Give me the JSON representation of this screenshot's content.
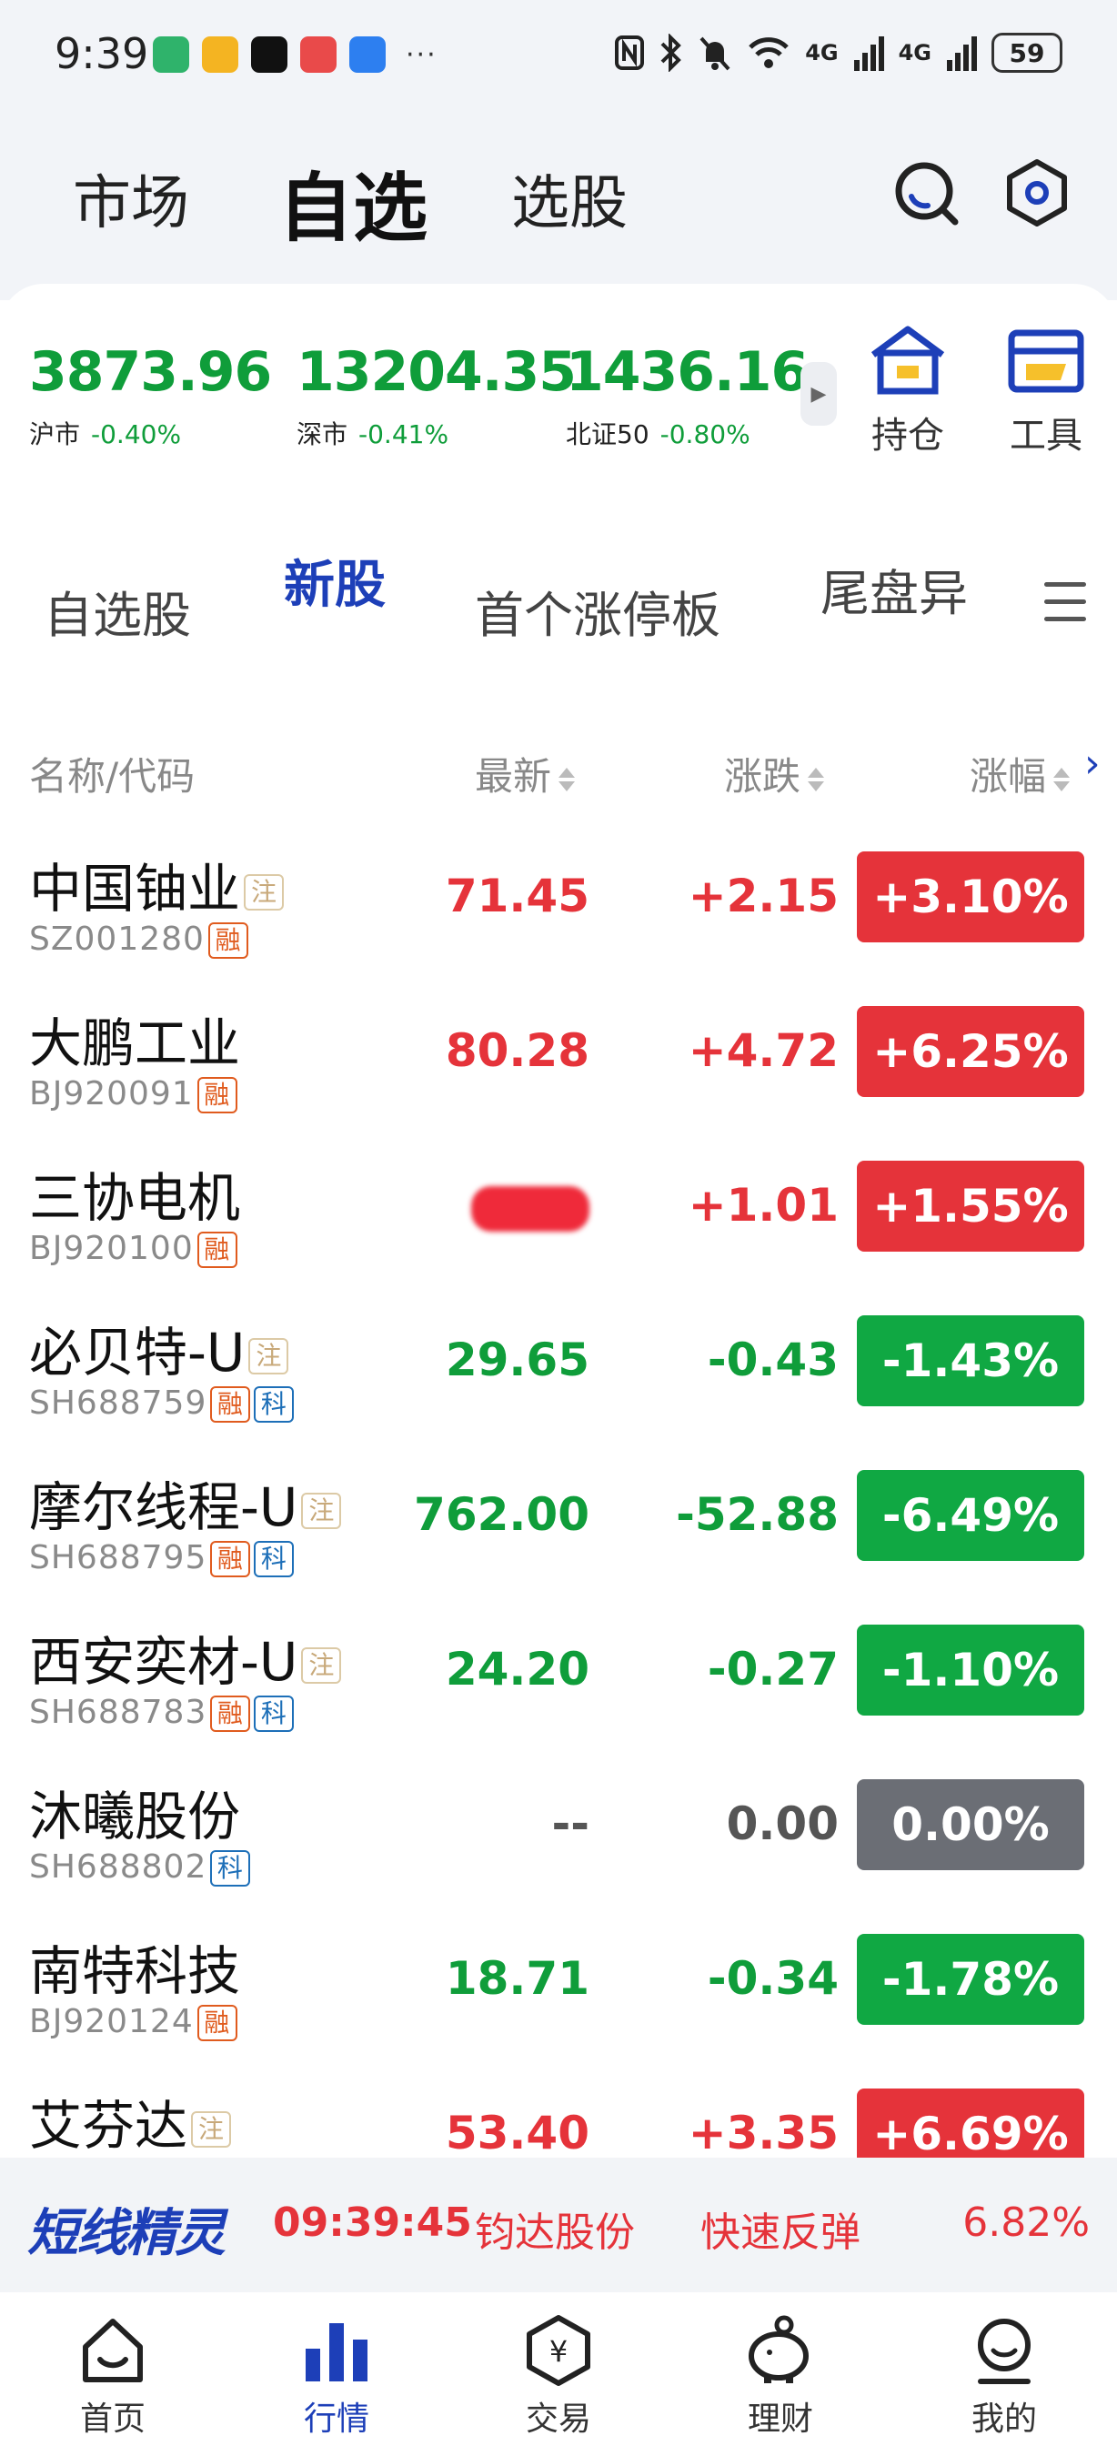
{
  "status_bar": {
    "time": "9:39",
    "more": "···",
    "battery": "59",
    "signal_label": "4G"
  },
  "header": {
    "tabs": [
      {
        "label": "市场"
      },
      {
        "label": "自选"
      },
      {
        "label": "选股"
      }
    ],
    "active_tab": "自选"
  },
  "indices": [
    {
      "name": "沪市",
      "value": "3873.96",
      "change": "-0.40%"
    },
    {
      "name": "深市",
      "value": "13204.35",
      "change": "-0.41%"
    },
    {
      "name": "北证50",
      "value": "1436.16",
      "change": "-0.80%"
    }
  ],
  "quick_actions": [
    {
      "label": "持仓",
      "icon": "holdings-icon"
    },
    {
      "label": "工具",
      "icon": "tools-icon"
    }
  ],
  "category_tabs": [
    {
      "label": "自选股"
    },
    {
      "label": "新股"
    },
    {
      "label": "首个涨停板"
    },
    {
      "label": "尾盘异"
    }
  ],
  "active_category": "新股",
  "table": {
    "columns": {
      "name": "名称/代码",
      "price": "最新",
      "change": "涨跌",
      "pct": "涨幅"
    },
    "rows": [
      {
        "name": "中国铀业",
        "code": "SZ001280",
        "note": true,
        "tags": [
          "融"
        ],
        "price": "71.45",
        "change": "+2.15",
        "pct": "+3.10%",
        "trend": "up"
      },
      {
        "name": "大鹏工业",
        "code": "BJ920091",
        "note": false,
        "tags": [
          "融"
        ],
        "price": "80.28",
        "change": "+4.72",
        "pct": "+6.25%",
        "trend": "up"
      },
      {
        "name": "三协电机",
        "code": "BJ920100",
        "note": false,
        "tags": [
          "融"
        ],
        "price": "",
        "change": "+1.01",
        "pct": "+1.55%",
        "trend": "up",
        "price_redacted": true
      },
      {
        "name": "必贝特-U",
        "code": "SH688759",
        "note": true,
        "tags": [
          "融",
          "科"
        ],
        "price": "29.65",
        "change": "-0.43",
        "pct": "-1.43%",
        "trend": "down"
      },
      {
        "name": "摩尔线程-U",
        "code": "SH688795",
        "note": true,
        "tags": [
          "融",
          "科"
        ],
        "price": "762.00",
        "change": "-52.88",
        "pct": "-6.49%",
        "trend": "down"
      },
      {
        "name": "西安奕材-U",
        "code": "SH688783",
        "note": true,
        "tags": [
          "融",
          "科"
        ],
        "price": "24.20",
        "change": "-0.27",
        "pct": "-1.10%",
        "trend": "down"
      },
      {
        "name": "沐曦股份",
        "code": "SH688802",
        "note": false,
        "tags": [
          "科"
        ],
        "price": "--",
        "change": "0.00",
        "pct": "0.00%",
        "trend": "flat"
      },
      {
        "name": "南特科技",
        "code": "BJ920124",
        "note": false,
        "tags": [
          "融"
        ],
        "price": "18.71",
        "change": "-0.34",
        "pct": "-1.78%",
        "trend": "down"
      },
      {
        "name": "艾芬达",
        "code": "",
        "note": true,
        "tags": [],
        "price": "53.40",
        "change": "+3.35",
        "pct": "+6.69%",
        "trend": "up"
      }
    ],
    "note_tag": "注"
  },
  "ticker": {
    "brand": "短线精灵",
    "time": "09:39:45",
    "stock": "钧达股份",
    "signal": "快速反弹",
    "pct": "6.82%"
  },
  "bottom_nav": [
    {
      "label": "首页",
      "icon": "home-icon"
    },
    {
      "label": "行情",
      "icon": "market-icon",
      "active": true
    },
    {
      "label": "交易",
      "icon": "trade-icon"
    },
    {
      "label": "理财",
      "icon": "finance-icon"
    },
    {
      "label": "我的",
      "icon": "profile-icon"
    }
  ],
  "colors": {
    "up": "#e5333a",
    "down": "#10a843",
    "flat": "#6b6e75",
    "accent": "#1d3fb8"
  }
}
